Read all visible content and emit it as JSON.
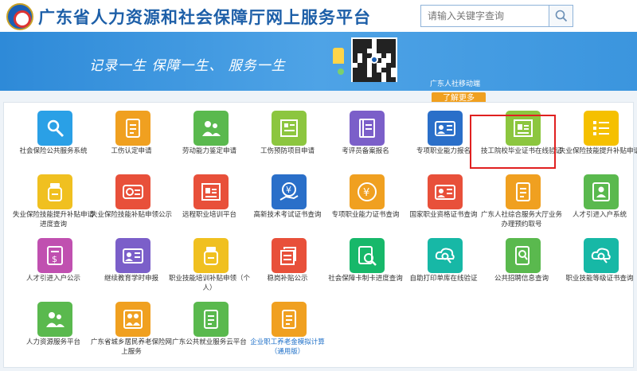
{
  "header": {
    "title": "广东省人力资源和社会保障厅网上服务平台"
  },
  "search": {
    "placeholder": "请输入关键字查询"
  },
  "banner": {
    "slogan": "记录一生   保障一生、   服务一生",
    "app_label": "广东人社移动端",
    "more": "了解更多"
  },
  "colors": {
    "blue": "#2aa0e6",
    "orange": "#f0a020",
    "green": "#5ab94e",
    "red": "#e8503a",
    "purple": "#9b5fc9",
    "teal": "#17b8a6",
    "pink": "#e050a0",
    "highlight": "#e02020"
  },
  "services": [
    {
      "label": "社会保险公共服务系统",
      "color": "#2aa0e6",
      "icon": "person-search-icon"
    },
    {
      "label": "工伤认定申请",
      "color": "#f0a020",
      "icon": "document-icon"
    },
    {
      "label": "劳动能力鉴定申请",
      "color": "#5ab94e",
      "icon": "people-icon"
    },
    {
      "label": "工伤预防项目申请",
      "color": "#8cc63f",
      "icon": "form-icon"
    },
    {
      "label": "考评员备案报名",
      "color": "#7b5fc9",
      "icon": "notebook-icon"
    },
    {
      "label": "专项职业能力报名",
      "color": "#2a6fc9",
      "icon": "id-card-icon"
    },
    {
      "label": "技工院校毕业证书在线验证",
      "color": "#8cc63f",
      "icon": "certificate-icon"
    },
    {
      "label": "失业保险技能提升补贴申请",
      "color": "#f5c000",
      "icon": "checklist-icon"
    },
    {
      "label": "失业保险技能提升补贴申请进度查询",
      "color": "#f0c020",
      "icon": "bottle-icon"
    },
    {
      "label": "失业保险技能补贴申领公示",
      "color": "#e8503a",
      "icon": "card-icon"
    },
    {
      "label": "远程职业培训平台",
      "color": "#e8503a",
      "icon": "certificate-icon"
    },
    {
      "label": "高新技术考试证书查询",
      "color": "#2a6fc9",
      "icon": "money-hand-icon"
    },
    {
      "label": "专项职业能力证书查询",
      "color": "#f0a020",
      "icon": "yen-icon"
    },
    {
      "label": "国家职业资格证书查询",
      "color": "#e8503a",
      "icon": "id-card-icon"
    },
    {
      "label": "广东人社综合服务大厅业务办理预约取号",
      "color": "#f0a020",
      "icon": "document-icon"
    },
    {
      "label": "人才引进入户系统",
      "color": "#5ab94e",
      "icon": "person-card-icon"
    },
    {
      "label": "人才引进入户公示",
      "color": "#c050b0",
      "icon": "money-doc-icon"
    },
    {
      "label": "继续教育学时申报",
      "color": "#7b5fc9",
      "icon": "id-card-icon"
    },
    {
      "label": "职业技能培训补贴申领（个人）",
      "color": "#f0c020",
      "icon": "bottle-icon"
    },
    {
      "label": "稳岗补贴公示",
      "color": "#e8503a",
      "icon": "stack-icon"
    },
    {
      "label": "社会保障卡制卡进度查询",
      "color": "#17b86a",
      "icon": "doc-search-icon"
    },
    {
      "label": "自助打印单库在线验证",
      "color": "#17b8a6",
      "icon": "cloud-search-icon"
    },
    {
      "label": "公共招聘信息查询",
      "color": "#5ab94e",
      "icon": "tablet-search-icon"
    },
    {
      "label": "职业技能等级证书查询",
      "color": "#17b8a6",
      "icon": "cloud-search-icon"
    },
    {
      "label": "人力资源服务平台",
      "color": "#5ab94e",
      "icon": "people-icon"
    },
    {
      "label": "广东省城乡居民养老保险网上服务",
      "color": "#f0a020",
      "icon": "elderly-icon"
    },
    {
      "label": "广东公共就业服务云平台",
      "color": "#5ab94e",
      "icon": "document-icon"
    },
    {
      "label": "企业职工养老金模拟计算（通用版）",
      "color": "#f0a020",
      "icon": "document-icon",
      "blue": true
    }
  ]
}
